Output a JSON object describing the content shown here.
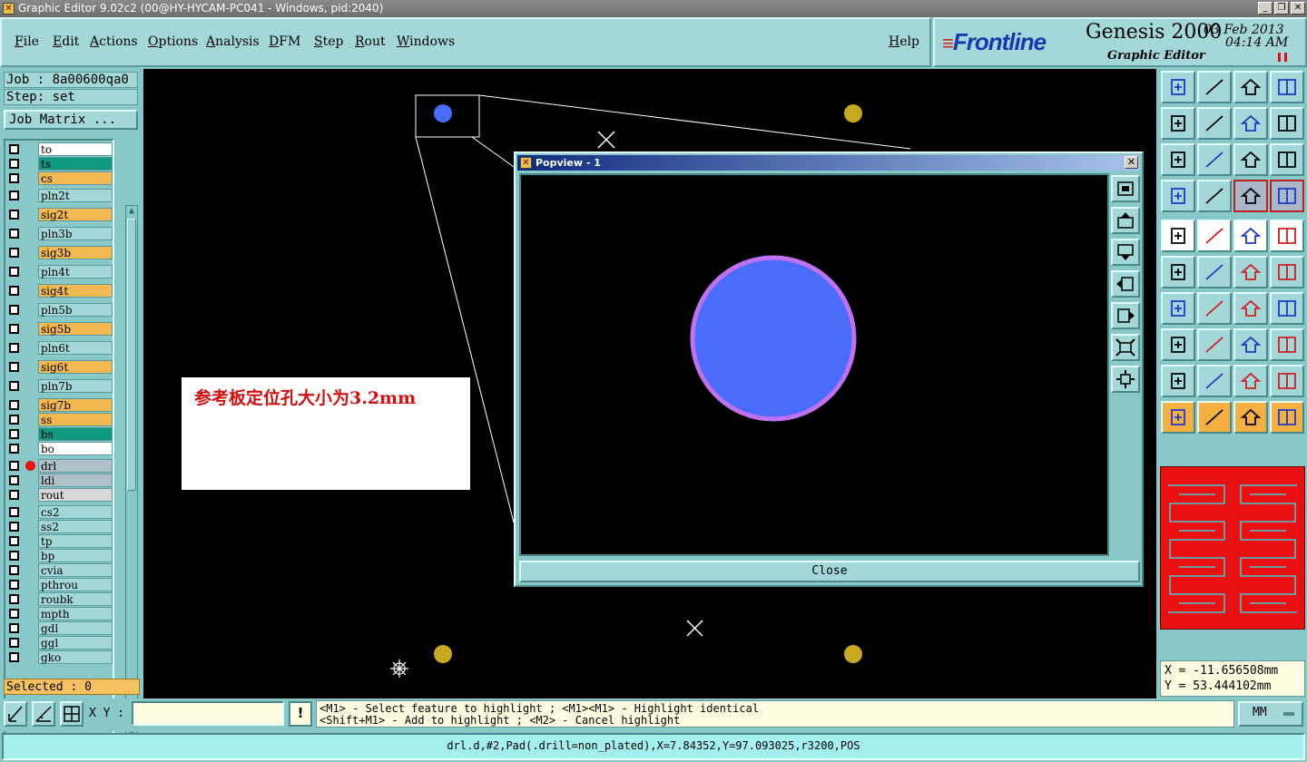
{
  "window": {
    "title": "Graphic Editor 9.02c2 (00@HY-HYCAM-PC041 - Windows, pid:2040)",
    "icon": "x-app-icon"
  },
  "menu": {
    "items": [
      "File",
      "Edit",
      "Actions",
      "Options",
      "Analysis",
      "DFM",
      "Step",
      "Rout",
      "Windows"
    ],
    "help": "Help"
  },
  "brand": {
    "logo": "Frontline",
    "product": "Genesis 2000",
    "subtitle": "Graphic Editor",
    "date": "03 Feb 2013",
    "time": "04:14 AM"
  },
  "job": {
    "job_label": "Job : 8a00600qa0",
    "step_label": "Step: set",
    "matrix_button": "Job Matrix ..."
  },
  "layers": {
    "items": [
      {
        "name": "to",
        "color": "#ffffff"
      },
      {
        "name": "ts",
        "color": "#109880"
      },
      {
        "name": "cs",
        "color": "#f4b850"
      },
      {
        "name": "pln2t",
        "color": "#a4d8d8"
      },
      {
        "name": "sig2t",
        "color": "#f4b850"
      },
      {
        "name": "pln3b",
        "color": "#a4d8d8"
      },
      {
        "name": "sig3b",
        "color": "#f4b850"
      },
      {
        "name": "pln4t",
        "color": "#a4d8d8"
      },
      {
        "name": "sig4t",
        "color": "#f4b850"
      },
      {
        "name": "pln5b",
        "color": "#a4d8d8"
      },
      {
        "name": "sig5b",
        "color": "#f4b850"
      },
      {
        "name": "pln6t",
        "color": "#a4d8d8"
      },
      {
        "name": "sig6t",
        "color": "#f4b850"
      },
      {
        "name": "pln7b",
        "color": "#a4d8d8"
      },
      {
        "name": "sig7b",
        "color": "#f4b850"
      },
      {
        "name": "ss",
        "color": "#f4b850"
      },
      {
        "name": "bs",
        "color": "#109880"
      },
      {
        "name": "bo",
        "color": "#ffffff"
      },
      {
        "name": "drl",
        "color": "#b0c0c8",
        "active": true
      },
      {
        "name": "ldi",
        "color": "#b0c0c8"
      },
      {
        "name": "rout",
        "color": "#d8d8d8"
      },
      {
        "name": "cs2",
        "color": "#a4d8d8"
      },
      {
        "name": "ss2",
        "color": "#a4d8d8"
      },
      {
        "name": "tp",
        "color": "#a4d8d8"
      },
      {
        "name": "bp",
        "color": "#a4d8d8"
      },
      {
        "name": "cvia",
        "color": "#a4d8d8"
      },
      {
        "name": "pthrou",
        "color": "#a4d8d8"
      },
      {
        "name": "roubk",
        "color": "#a4d8d8"
      },
      {
        "name": "mpth",
        "color": "#a4d8d8"
      },
      {
        "name": "gdl",
        "color": "#a4d8d8"
      },
      {
        "name": "ggl",
        "color": "#a4d8d8"
      },
      {
        "name": "gko",
        "color": "#a4d8d8"
      }
    ]
  },
  "selected_label": "Selected : 0",
  "annotation": "参考板定位孔大小为3.2mm",
  "popview": {
    "title": "Popview - 1",
    "close_label": "Close"
  },
  "coords": {
    "x": "X = -11.656508mm",
    "y": "Y = 53.444102mm"
  },
  "bottom": {
    "xy_label": "X Y :",
    "xy_value": "",
    "warn": "!",
    "message_line1": "<M1> - Select feature to highlight ; <M1><M1> - Highlight identical",
    "message_line2": "<Shift+M1> - Add to highlight ; <M2> - Cancel highlight",
    "units": "MM"
  },
  "status": "drl.d,#2,Pad(.drill=non_plated),X=7.84352,Y=97.093025,r3200,POS",
  "colors": {
    "canvas": "#000000",
    "pad_blue": "#4a6cf8",
    "pad_outline": "#c070f0",
    "pad_yellow": "#c8a820",
    "annotation_text": "#d01010"
  }
}
